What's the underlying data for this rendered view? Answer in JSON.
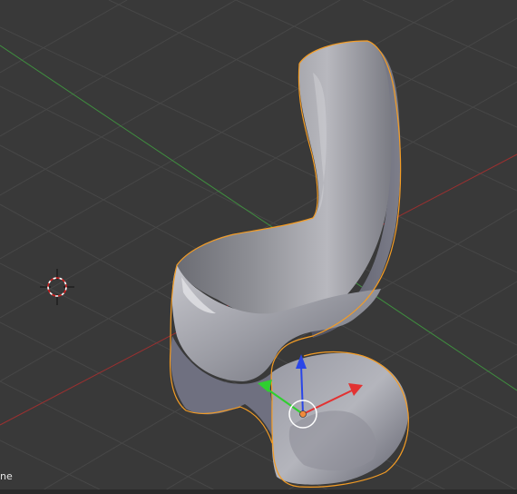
{
  "viewport": {
    "corner_label": "ne"
  },
  "colors": {
    "background": "#393939",
    "grid": "#474747",
    "x_axis": "#a83333",
    "y_axis": "#3f9a3f",
    "selection_outline": "#f39c25",
    "mesh_light": "#c9c9cf",
    "mesh_dark": "#5a5b66",
    "gizmo_x": "#e23232",
    "gizmo_y": "#2fcf2f",
    "gizmo_z": "#2a46e8",
    "gizmo_center": "#ffffff",
    "origin_dot": "#f08a3c"
  },
  "icons": {
    "cursor": "3d-cursor-icon",
    "gizmo": "transform-gizmo-icon"
  },
  "selected_object": "chair-mesh"
}
